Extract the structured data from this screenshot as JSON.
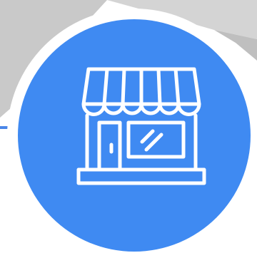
{
  "icon": {
    "name": "storefront-icon",
    "badge_color": "#3f8af2",
    "ring_color": "#ffffff",
    "line_color": "#ffffff",
    "backdrop_color": "#c9c9c9",
    "accent_line_color": "#4a86e8"
  }
}
